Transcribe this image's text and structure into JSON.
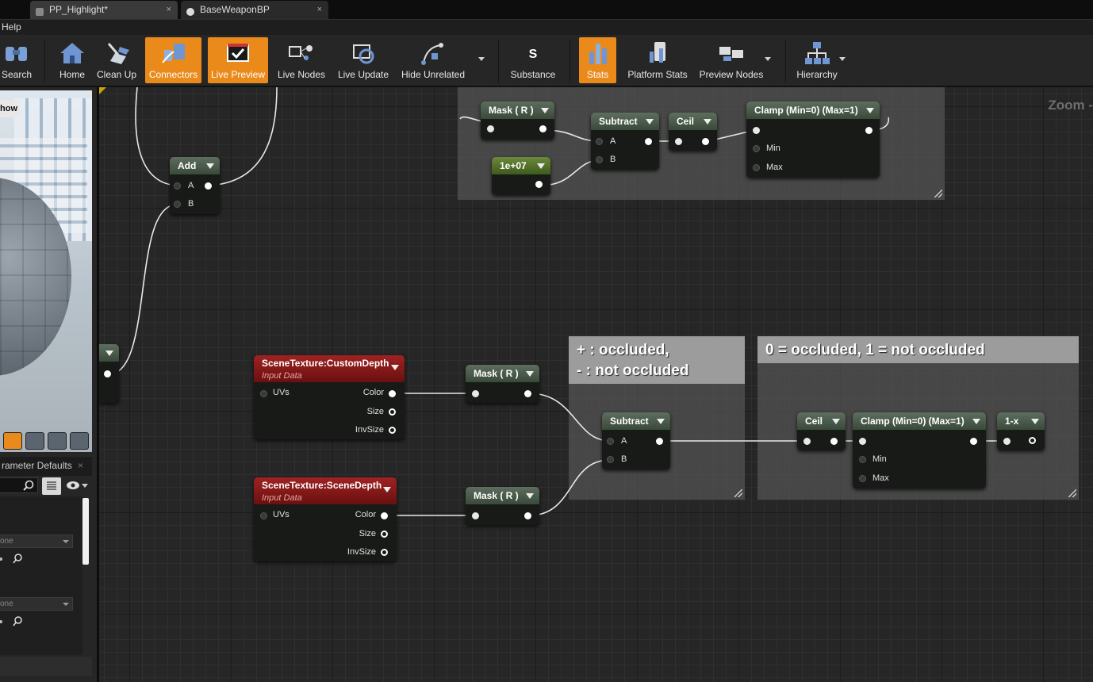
{
  "tabs": [
    {
      "label": "PP_Highlight*",
      "close": "×"
    },
    {
      "label": "BaseWeaponBP",
      "close": "×"
    }
  ],
  "menu": {
    "help": "Help"
  },
  "toolbar": {
    "buttons": [
      {
        "label": "Search",
        "active": false,
        "icon": "binoculars-icon"
      },
      {
        "label": "Home",
        "active": false,
        "icon": "home-icon"
      },
      {
        "label": "Clean Up",
        "active": false,
        "icon": "broom-icon"
      },
      {
        "label": "Connectors",
        "active": true,
        "icon": "connectors-icon"
      },
      {
        "label": "Live Preview",
        "active": true,
        "icon": "monitor-check-icon"
      },
      {
        "label": "Live Nodes",
        "active": false,
        "icon": "live-nodes-icon"
      },
      {
        "label": "Live Update",
        "active": false,
        "icon": "live-update-icon"
      },
      {
        "label": "Hide Unrelated",
        "active": false,
        "icon": "hide-unrelated-icon"
      },
      {
        "label": "Substance",
        "active": false,
        "icon": "substance-icon"
      },
      {
        "label": "Stats",
        "active": true,
        "icon": "stats-icon"
      },
      {
        "label": "Platform Stats",
        "active": false,
        "icon": "platform-stats-icon"
      },
      {
        "label": "Preview Nodes",
        "active": false,
        "icon": "preview-nodes-icon"
      },
      {
        "label": "Hierarchy",
        "active": false,
        "icon": "hierarchy-icon"
      }
    ],
    "accent": "#e98a1a"
  },
  "viewport": {
    "show_button": "how"
  },
  "param_defaults": {
    "title": "rameter Defaults",
    "close": "×",
    "combo1": "one",
    "combo2": "one"
  },
  "graph": {
    "zoom": "Zoom -",
    "comments": {
      "occluded_sign": "+ : occluded,\n- : not occluded",
      "occluded_binary": "0 = occluded, 1 = not occluded"
    },
    "nodes": {
      "add": {
        "title": "Add",
        "a": "A",
        "b": "B"
      },
      "mask_top": {
        "title": "Mask ( R )"
      },
      "const_top": {
        "title": "1e+07"
      },
      "subtract_top": {
        "title": "Subtract",
        "a": "A",
        "b": "B"
      },
      "ceil_top": {
        "title": "Ceil"
      },
      "clamp_top": {
        "title": "Clamp (Min=0) (Max=1)",
        "min": "Min",
        "max": "Max"
      },
      "custom_depth": {
        "title": "SceneTexture:CustomDepth",
        "sub": "Input Data",
        "uvs": "UVs",
        "color": "Color",
        "size": "Size",
        "invsize": "InvSize"
      },
      "scene_depth": {
        "title": "SceneTexture:SceneDepth",
        "sub": "Input Data",
        "uvs": "UVs",
        "color": "Color",
        "size": "Size",
        "invsize": "InvSize"
      },
      "mask_cd": {
        "title": "Mask ( R )"
      },
      "mask_sd": {
        "title": "Mask ( R )"
      },
      "subtract_mid": {
        "title": "Subtract",
        "a": "A",
        "b": "B"
      },
      "ceil_mid": {
        "title": "Ceil"
      },
      "clamp_mid": {
        "title": "Clamp (Min=0) (Max=1)",
        "min": "Min",
        "max": "Max"
      },
      "one_minus": {
        "title": "1-x"
      }
    }
  }
}
